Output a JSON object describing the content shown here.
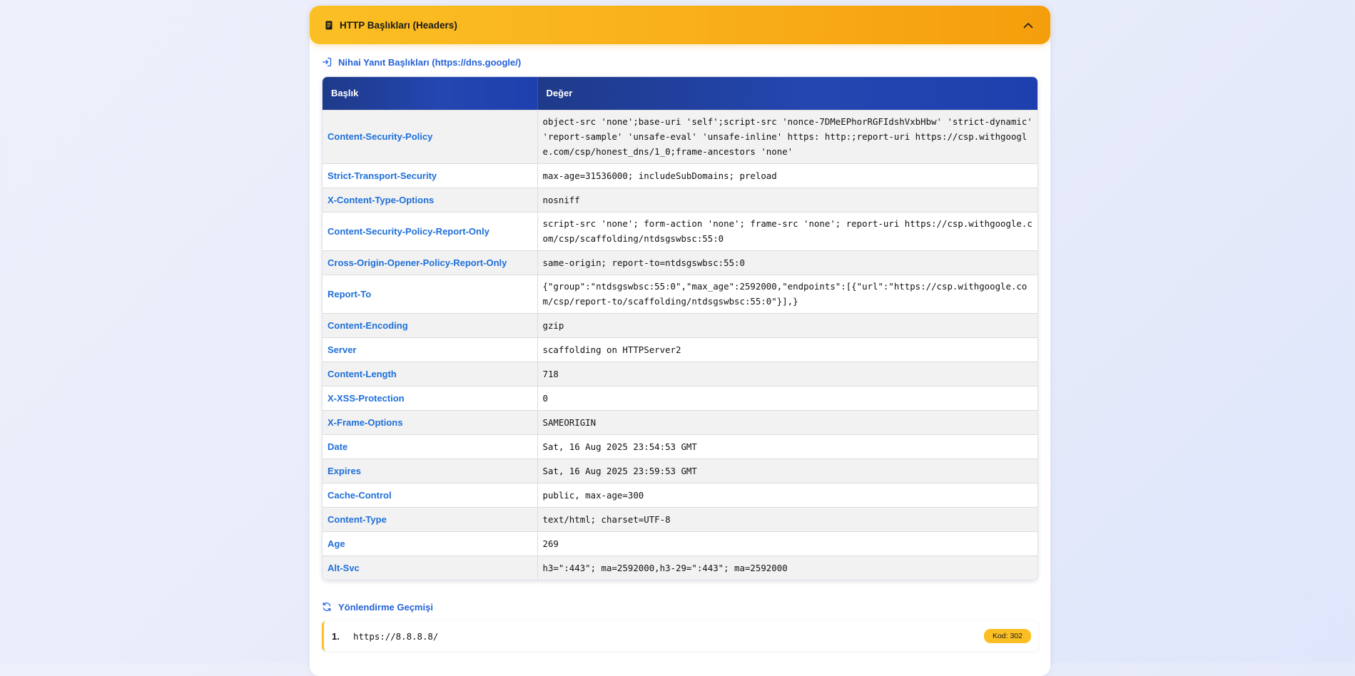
{
  "panel": {
    "title": "HTTP Başlıkları (Headers)",
    "header_icon": "document-icon",
    "collapse_icon": "chevron-up-icon"
  },
  "final_headers": {
    "label": "Nihai Yanıt Başlıkları (https://dns.google/)",
    "icon": "sign-in-icon",
    "columns": [
      "Başlık",
      "Değer"
    ],
    "rows": [
      {
        "name": "Content-Security-Policy",
        "value": "object-src 'none';base-uri 'self';script-src 'nonce-7DMeEPhorRGFIdshVxbHbw' 'strict-dynamic' 'report-sample' 'unsafe-eval' 'unsafe-inline' https: http:;report-uri https://csp.withgoogle.com/csp/honest_dns/1_0;frame-ancestors 'none'"
      },
      {
        "name": "Strict-Transport-Security",
        "value": "max-age=31536000; includeSubDomains; preload"
      },
      {
        "name": "X-Content-Type-Options",
        "value": "nosniff"
      },
      {
        "name": "Content-Security-Policy-Report-Only",
        "value": "script-src 'none'; form-action 'none'; frame-src 'none'; report-uri https://csp.withgoogle.com/csp/scaffolding/ntdsgswbsc:55:0"
      },
      {
        "name": "Cross-Origin-Opener-Policy-Report-Only",
        "value": "same-origin; report-to=ntdsgswbsc:55:0"
      },
      {
        "name": "Report-To",
        "value": "{\"group\":\"ntdsgswbsc:55:0\",\"max_age\":2592000,\"endpoints\":[{\"url\":\"https://csp.withgoogle.com/csp/report-to/scaffolding/ntdsgswbsc:55:0\"}],}"
      },
      {
        "name": "Content-Encoding",
        "value": "gzip"
      },
      {
        "name": "Server",
        "value": "scaffolding on HTTPServer2"
      },
      {
        "name": "Content-Length",
        "value": "718"
      },
      {
        "name": "X-XSS-Protection",
        "value": "0"
      },
      {
        "name": "X-Frame-Options",
        "value": "SAMEORIGIN"
      },
      {
        "name": "Date",
        "value": "Sat, 16 Aug 2025 23:54:53 GMT"
      },
      {
        "name": "Expires",
        "value": "Sat, 16 Aug 2025 23:59:53 GMT"
      },
      {
        "name": "Cache-Control",
        "value": "public, max-age=300"
      },
      {
        "name": "Content-Type",
        "value": "text/html; charset=UTF-8"
      },
      {
        "name": "Age",
        "value": "269"
      },
      {
        "name": "Alt-Svc",
        "value": "h3=\":443\"; ma=2592000,h3-29=\":443\"; ma=2592000"
      }
    ]
  },
  "redirects": {
    "label": "Yönlendirme Geçmişi",
    "icon": "refresh-icon",
    "items": [
      {
        "number": "1.",
        "url": "https://8.8.8.8/",
        "code": "Kod: 302"
      }
    ]
  },
  "colors": {
    "header_gradient_start": "#fbbf24",
    "header_gradient_end": "#f59e0b",
    "table_header": "#1e3a8a",
    "link_blue": "#1e6fd9",
    "badge": "#fbbf24"
  }
}
